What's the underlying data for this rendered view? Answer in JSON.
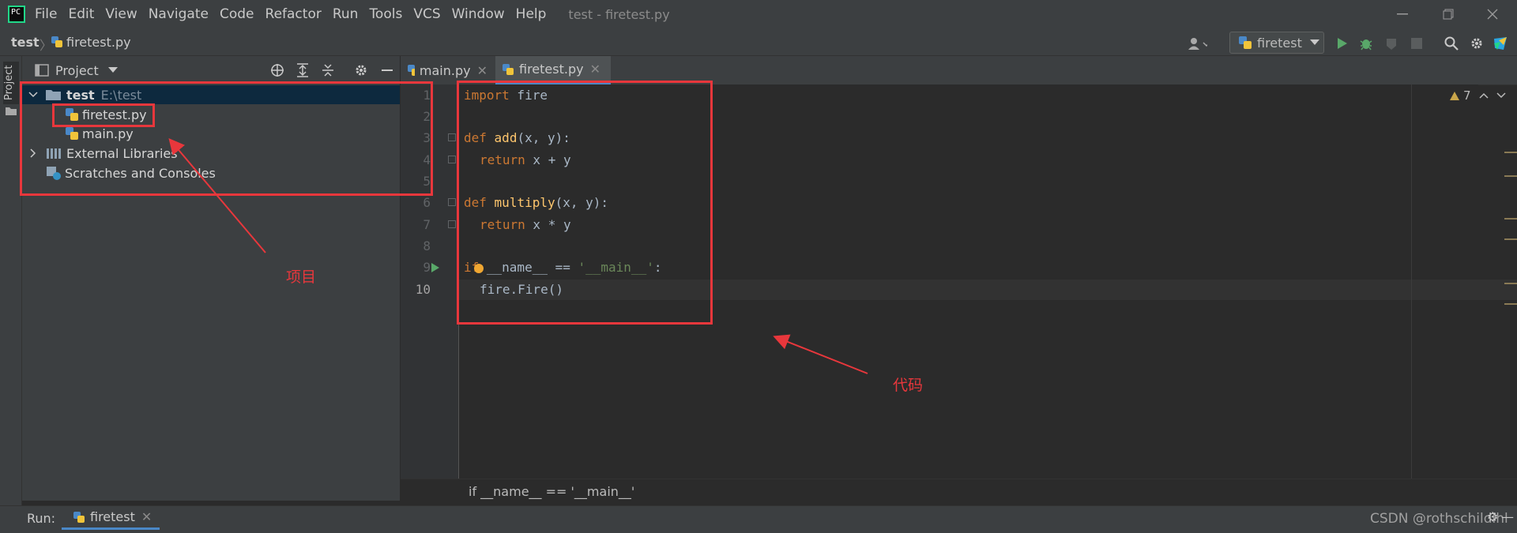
{
  "menubar": {
    "items": [
      "File",
      "Edit",
      "View",
      "Navigate",
      "Code",
      "Refactor",
      "Run",
      "Tools",
      "VCS",
      "Window",
      "Help"
    ],
    "window_title": "test - firetest.py",
    "logo_text": "PC"
  },
  "navbar": {
    "project": "test",
    "file": "firetest.py",
    "run_config": "firetest"
  },
  "project_panel": {
    "title": "Project",
    "side_label": "Project",
    "tree": {
      "root_name": "test",
      "root_path": "E:\\test",
      "file1": "firetest.py",
      "file2": "main.py",
      "ext_libs": "External Libraries",
      "scratches": "Scratches and Consoles"
    }
  },
  "editor": {
    "tabs": [
      "main.py",
      "firetest.py"
    ],
    "line_numbers": [
      "1",
      "2",
      "3",
      "4",
      "5",
      "6",
      "7",
      "8",
      "9",
      "10"
    ],
    "warning_count": "7",
    "code": {
      "l1_kw": "import",
      "l1_rest": " fire",
      "l3_kw": "def",
      "l3_fn": "add",
      "l3_rest": "(x, y):",
      "l4_kw": "return",
      "l4_rest": " x + y",
      "l6_kw": "def",
      "l6_fn": "multiply",
      "l6_rest": "(x, y):",
      "l7_kw": "return",
      "l7_rest": " x * y",
      "l9_kw": "if",
      "l9_rest": " __name__ == ",
      "l9_str": "'__main__'",
      "l9_end": ":",
      "l10_text": "fire.Fire()"
    },
    "breadcrumb": "if __name__ == '__main__'"
  },
  "run_bar": {
    "label": "Run:",
    "tab": "firetest"
  },
  "annotations": {
    "project": "项目",
    "code": "代码"
  },
  "watermark": "CSDN @rothschildlhl",
  "colors": {
    "annotation_red": "#e8373c",
    "keyword": "#cc7832",
    "function": "#ffc66d",
    "string": "#6a8759"
  }
}
